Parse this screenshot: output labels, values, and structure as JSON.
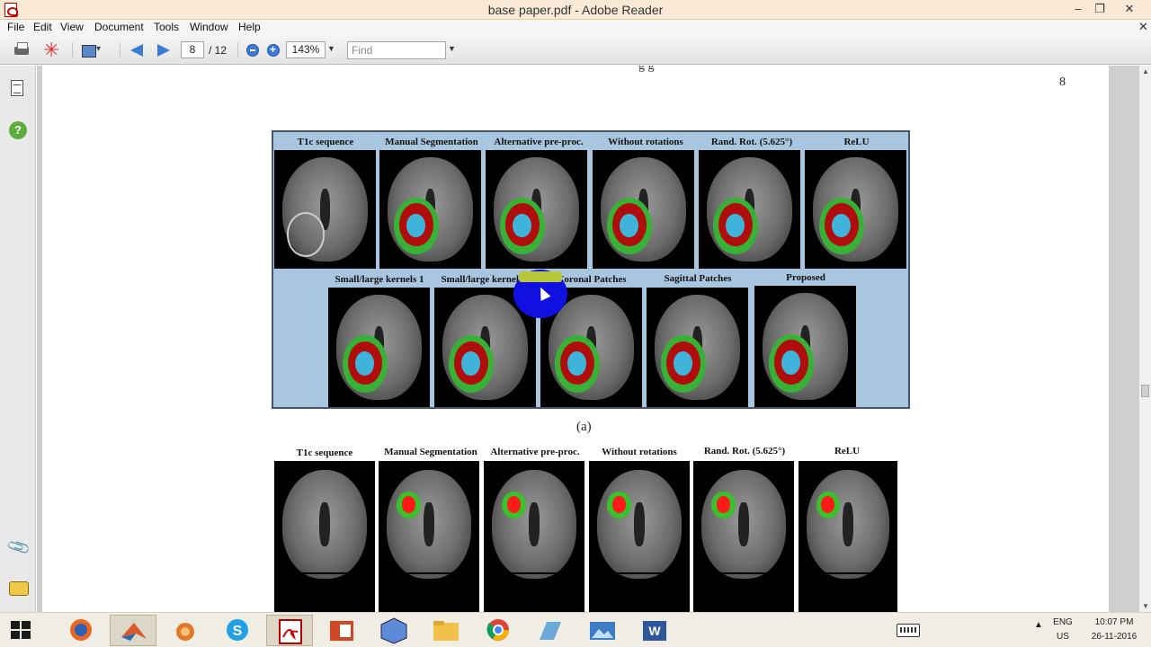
{
  "window": {
    "title": "base paper.pdf - Adobe Reader",
    "minimize_glyph": "–",
    "maximize_glyph": "❐",
    "close_glyph": "✕"
  },
  "menu": {
    "items": [
      "File",
      "Edit",
      "View",
      "Document",
      "Tools",
      "Window",
      "Help"
    ],
    "doc_close_glyph": "✕"
  },
  "toolbar": {
    "current_page": "8",
    "total_pages": "/ 12",
    "zoom": "143%",
    "find_placeholder": "Find"
  },
  "document": {
    "page_number": "8",
    "top_fragment": "g g",
    "figure_a": {
      "row1_labels": [
        "T1c sequence",
        "Manual Segmentation",
        "Alternative pre-proc.",
        "Without rotations",
        "Rand. Rot. (5.625°)",
        "ReLU"
      ],
      "row2_labels": [
        "Small/large kernels 1",
        "Small/large kernels 2",
        "Coronal Patches",
        "Sagittal Patches",
        "Proposed"
      ],
      "caption": "(a)"
    },
    "figure_b": {
      "labels": [
        "T1c sequence",
        "Manual Segmentation",
        "Alternative pre-proc.",
        "Without rotations",
        "Rand. Rot. (5.625°)",
        "ReLU"
      ]
    }
  },
  "taskbar": {
    "apps": [
      "windows-start",
      "firefox",
      "matlab",
      "app-orange",
      "skype",
      "adobe-reader",
      "powerpoint",
      "virtualbox",
      "file-explorer",
      "chrome",
      "app-blue",
      "photo-viewer",
      "word"
    ],
    "lang_top": "ENG",
    "lang_bottom": "US",
    "time": "10:07 PM",
    "date": "26-11-2016"
  },
  "colors": {
    "titlebar": "#fbe9d7",
    "figure_bg": "#a9c6e0",
    "edema": "#38b236",
    "necrosis": "#b00d0d",
    "enhancing": "#3fb3d9"
  }
}
